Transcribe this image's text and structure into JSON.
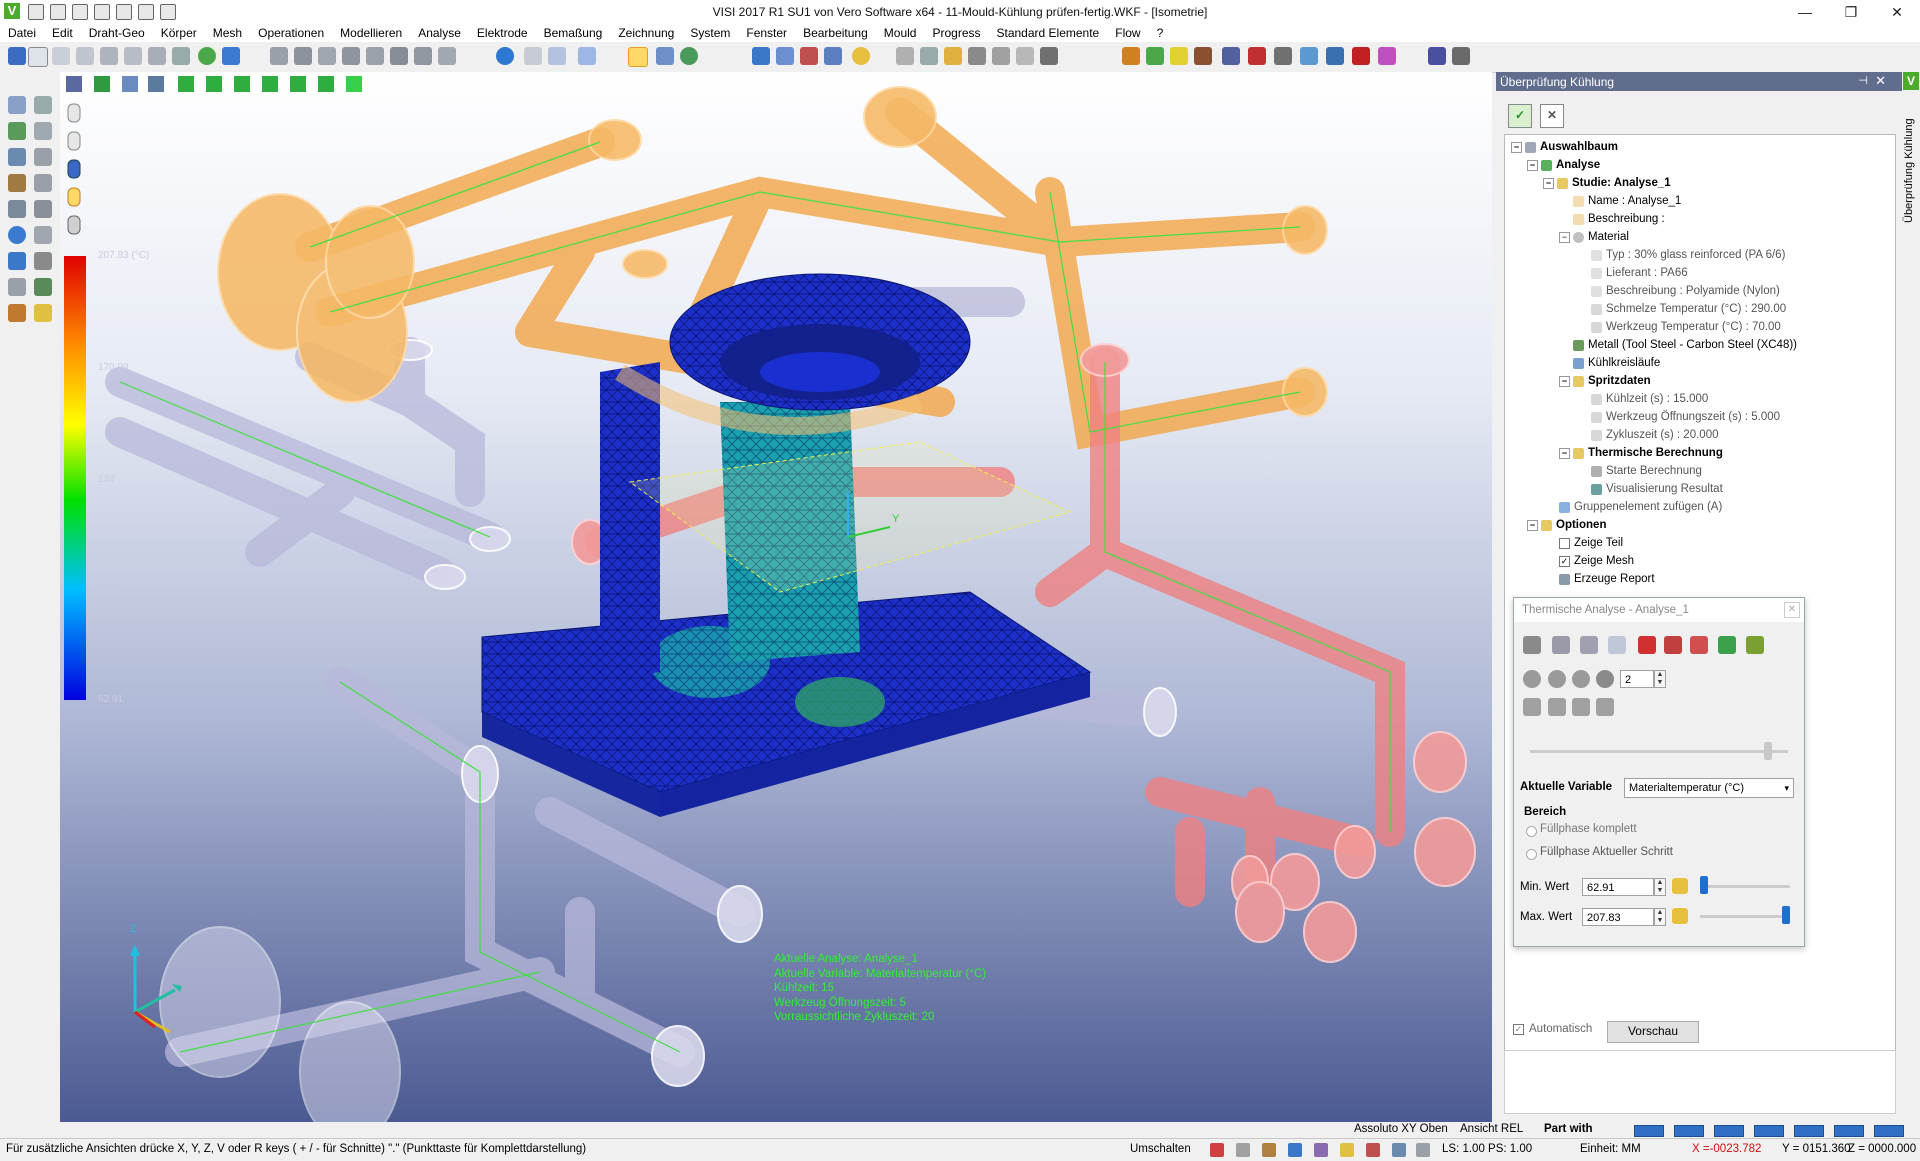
{
  "window": {
    "title": "VISI 2017 R1 SU1 von Vero Software x64 - 11-Mould-Kühlung prüfen-fertig.WKF - [Isometrie]",
    "app_logo": "V",
    "controls": [
      "—",
      "❐",
      "✕"
    ]
  },
  "menu": [
    "Datei",
    "Edit",
    "Draht-Geo",
    "Körper",
    "Mesh",
    "Operationen",
    "Modellieren",
    "Analyse",
    "Elektrode",
    "Bemaßung",
    "Zeichnung",
    "System",
    "Fenster",
    "Bearbeitung",
    "Mould",
    "Progress",
    "Standard Elemente",
    "Flow",
    "?"
  ],
  "viewport": {
    "legend": {
      "colors": [
        "#e00000",
        "#ff8c00",
        "#ffff00",
        "#00e000",
        "#00c0ff",
        "#0000e0"
      ],
      "labels": [
        "207.83 (°C)",
        "170.99",
        "134",
        "97.3",
        "62.91"
      ]
    },
    "info": {
      "line1": "Aktuelle Analyse:   Analyse_1",
      "line2": "Aktuelle Variable:   Materialtemperatur (°C)",
      "line3": "Kühlzeit:   15",
      "line4": "Werkzeug Öffnungszeit:   5",
      "line5": "Vorraussichtliche Zykluszeit:   20"
    },
    "axis": {
      "x": "X",
      "y": "Y",
      "z": "Z"
    }
  },
  "panel": {
    "title": "Überprüfung Kühlung",
    "pin": "⊣",
    "close": "✕",
    "vertical_tab": "Überprüfung Kühlung",
    "ok_label": "✓",
    "cancel_label": "✕",
    "tree": [
      {
        "label": "Auswahlbaum",
        "bold": true
      },
      {
        "label": "Analyse",
        "bold": true
      },
      {
        "label": "Studie: Analyse_1",
        "bold": true
      },
      {
        "label": "Name : Analyse_1"
      },
      {
        "label": "Beschreibung :"
      },
      {
        "label": "Material"
      },
      {
        "label": "Typ : 30% glass reinforced (PA 6/6)"
      },
      {
        "label": "Lieferant : PA66"
      },
      {
        "label": "Beschreibung : Polyamide (Nylon)"
      },
      {
        "label": "Schmelze Temperatur (°C) : 290.00"
      },
      {
        "label": "Werkzeug Temperatur (°C) : 70.00"
      },
      {
        "label": "Metall (Tool Steel - Carbon Steel (XC48))"
      },
      {
        "label": "Kühlkreisläufe"
      },
      {
        "label": "Spritzdaten",
        "bold": true
      },
      {
        "label": "Kühlzeit (s) : 15.000"
      },
      {
        "label": "Werkzeug Öffnungszeit (s) : 5.000"
      },
      {
        "label": "Zykluszeit (s) : 20.000"
      },
      {
        "label": "Thermische Berechnung",
        "bold": true
      },
      {
        "label": "Starte Berechnung"
      },
      {
        "label": "Visualisierung Resultat"
      },
      {
        "label": "Gruppenelement zufügen (A)"
      },
      {
        "label": "Optionen",
        "bold": true
      },
      {
        "label": "Zeige Teil"
      },
      {
        "label": "Zeige Mesh"
      },
      {
        "label": "Erzeuge Report"
      }
    ],
    "checks": {
      "zeige_teil": false,
      "zeige_mesh": true
    }
  },
  "dialog": {
    "title": "Thermische Analyse - Analyse_1",
    "close": "✕",
    "step_value": "2",
    "variable_label": "Aktuelle Variable",
    "variable_value": "Materialtemperatur (°C)",
    "bereich_label": "Bereich",
    "radio1": "Füllphase komplett",
    "radio2": "Füllphase Aktueller Schritt",
    "min_label": "Min. Wert",
    "min_value": "62.91",
    "max_label": "Max. Wert",
    "max_value": "207.83",
    "min_slider_level": 0.0,
    "max_slider_level": 1.0
  },
  "automatisch_label": "Automatisch",
  "automatisch_checked": true,
  "preview_label": "Vorschau",
  "viewbar": {
    "assoluto": "Assoluto XY Oben",
    "ansicht": "Ansicht REL",
    "partwith": "Part with"
  },
  "statusbar": {
    "hint": "Für zusätzliche Ansichten drücke X, Y, Z, V oder R keys ( + / - für Schnitte) \".\" (Punkttaste für Komplettdarstellung)",
    "umschalten": "Umschalten",
    "ls": "LS: 1.00 PS: 1.00",
    "einheit": "Einheit: MM",
    "x": "X =-0023.782",
    "y": "Y = 0151.360",
    "z": "Z = 0000.000"
  },
  "colors": {
    "accent_blue": "#1f6fd0",
    "panel_header": "#616d8d",
    "vero_green": "#4caa2c",
    "info_green": "#2ef22e",
    "pipe_orange": "#f2a64a",
    "pipe_red": "#ef8080",
    "pipe_lilac": "#c8c8e6",
    "mesh_blue": "#1c2fc8"
  }
}
